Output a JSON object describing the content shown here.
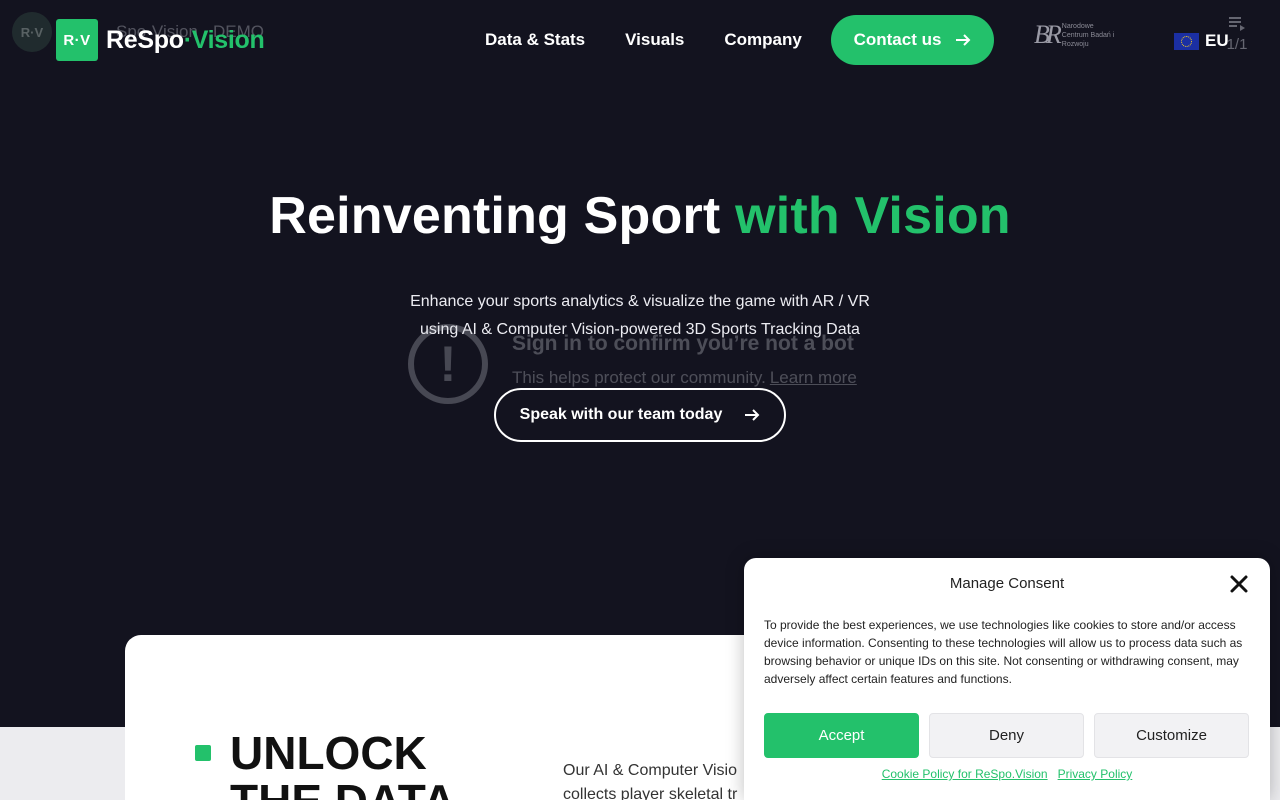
{
  "youtube_overlay": {
    "avatar": "R·V",
    "title": "Spo·Vision · DEMO",
    "queue_count": "1/1"
  },
  "logo": {
    "badge": "R·V",
    "name_part1": "ReSpo",
    "name_part2": "·Vision"
  },
  "nav": {
    "items": [
      "Data & Stats",
      "Visuals",
      "Company"
    ],
    "contact_label": "Contact us"
  },
  "partner": {
    "mark": "BR",
    "text": "Narodowe Centrum Badań i Rozwoju"
  },
  "language": {
    "label": "EU"
  },
  "hero": {
    "title_part1": "Reinventing Sport ",
    "title_part2": "with Vision",
    "subtitle": "Enhance your sports analytics & visualize the game with AR / VR using AI & Computer Vision-powered 3D Sports Tracking Data",
    "cta_label": "Speak with our team today"
  },
  "bot_overlay": {
    "heading": "Sign in to confirm you’re not a bot",
    "text": "This helps protect our community.",
    "link": "Learn more"
  },
  "section": {
    "title_line1": "UNLOCK",
    "title_line2": "THE DATA",
    "text_line1": "Our AI & Computer Visio",
    "text_line2": "collects player skeletal tr"
  },
  "consent": {
    "title": "Manage Consent",
    "body": "To provide the best experiences, we use technologies like cookies to store and/or access device information. Consenting to these technologies will allow us to process data such as browsing behavior or unique IDs on this site. Not consenting or withdrawing consent, may adversely affect certain features and functions.",
    "accept": "Accept",
    "deny": "Deny",
    "customize": "Customize",
    "cookie_policy": "Cookie Policy for ReSpo.Vision",
    "privacy_policy": "Privacy Policy"
  },
  "colors": {
    "background": "#13131f",
    "accent": "#23c16b"
  }
}
